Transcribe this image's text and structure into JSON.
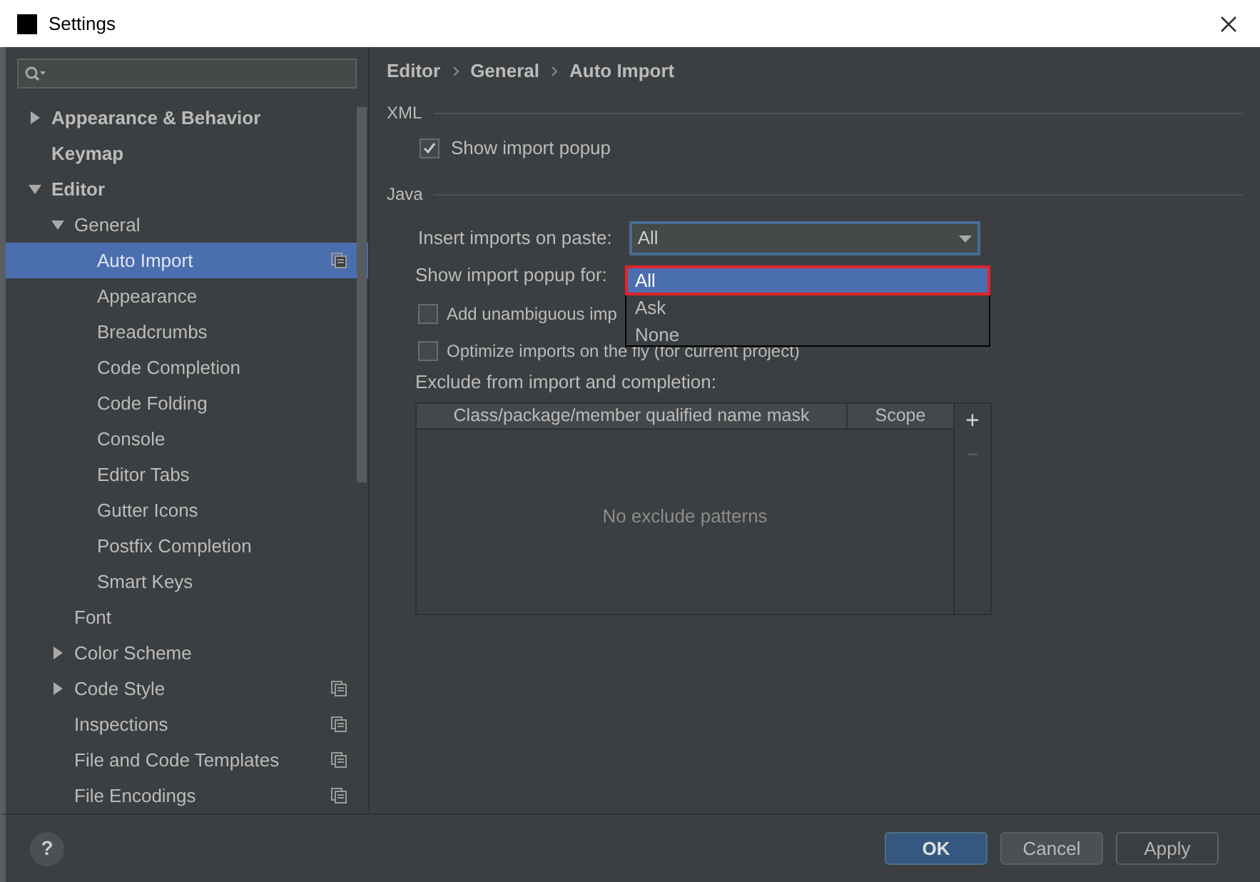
{
  "window": {
    "title": "Settings"
  },
  "sidebar": {
    "tree": [
      {
        "label": "Appearance & Behavior",
        "expanded": false,
        "has_children": true,
        "selected": false,
        "project_scoped": false
      },
      {
        "label": "Keymap",
        "has_children": false,
        "selected": false,
        "project_scoped": false
      },
      {
        "label": "Editor",
        "expanded": true,
        "has_children": true,
        "selected": false,
        "project_scoped": false,
        "children": [
          {
            "label": "General",
            "expanded": true,
            "has_children": true,
            "selected": false,
            "project_scoped": false,
            "children": [
              {
                "label": "Auto Import",
                "selected": true,
                "project_scoped": true
              },
              {
                "label": "Appearance",
                "selected": false,
                "project_scoped": false
              },
              {
                "label": "Breadcrumbs",
                "selected": false,
                "project_scoped": false
              },
              {
                "label": "Code Completion",
                "selected": false,
                "project_scoped": false
              },
              {
                "label": "Code Folding",
                "selected": false,
                "project_scoped": false
              },
              {
                "label": "Console",
                "selected": false,
                "project_scoped": false
              },
              {
                "label": "Editor Tabs",
                "selected": false,
                "project_scoped": false
              },
              {
                "label": "Gutter Icons",
                "selected": false,
                "project_scoped": false
              },
              {
                "label": "Postfix Completion",
                "selected": false,
                "project_scoped": false
              },
              {
                "label": "Smart Keys",
                "selected": false,
                "project_scoped": false
              }
            ]
          },
          {
            "label": "Font",
            "has_children": false,
            "selected": false,
            "project_scoped": false
          },
          {
            "label": "Color Scheme",
            "expanded": false,
            "has_children": true,
            "selected": false,
            "project_scoped": false
          },
          {
            "label": "Code Style",
            "expanded": false,
            "has_children": true,
            "selected": false,
            "project_scoped": true
          },
          {
            "label": "Inspections",
            "has_children": false,
            "selected": false,
            "project_scoped": true
          },
          {
            "label": "File and Code Templates",
            "has_children": false,
            "selected": false,
            "project_scoped": true
          },
          {
            "label": "File Encodings",
            "has_children": false,
            "selected": false,
            "project_scoped": true
          }
        ]
      }
    ]
  },
  "breadcrumb": [
    "Editor",
    "General",
    "Auto Import"
  ],
  "xml": {
    "title": "XML",
    "show_import_popup": {
      "label": "Show import popup",
      "checked": true
    }
  },
  "java": {
    "title": "Java",
    "insert_imports": {
      "label": "Insert imports on paste:",
      "value": "All"
    },
    "show_popup_for": {
      "label": "Show import popup for:"
    },
    "options": [
      {
        "label": "Add unambiguous imp",
        "checked": false
      },
      {
        "label": "Optimize imports on the fly (for current project)",
        "checked": false
      }
    ],
    "exclude": {
      "label": "Exclude from import and completion:",
      "columns": [
        "Class/package/member qualified name mask",
        "Scope"
      ],
      "empty_text": "No exclude patterns",
      "add": "+",
      "remove": "−"
    }
  },
  "dropdown_popup": {
    "options": [
      {
        "label": "All",
        "selected": true,
        "annotated": true
      },
      {
        "label": "Ask",
        "selected": false,
        "annotated": false
      },
      {
        "label": "None",
        "selected": false,
        "annotated": false
      }
    ]
  },
  "help": "?",
  "buttons": [
    {
      "label": "OK",
      "kind": "default",
      "disabled": false
    },
    {
      "label": "Cancel",
      "kind": "normal",
      "disabled": false
    },
    {
      "label": "Apply",
      "kind": "normal",
      "disabled": true
    }
  ]
}
